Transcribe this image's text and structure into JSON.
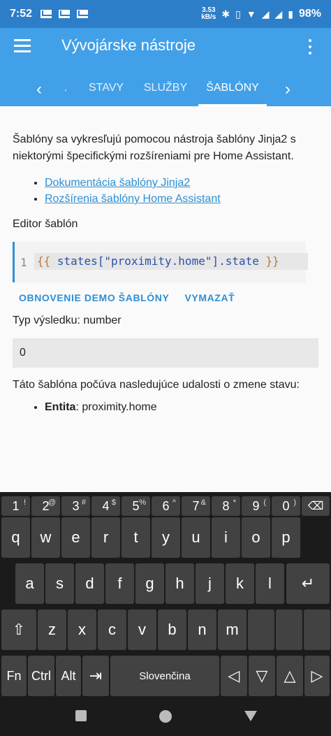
{
  "status": {
    "time": "7:52",
    "speed": "3.53\nkB/s",
    "battery": "98%"
  },
  "app": {
    "title": "Vývojárske nástroje"
  },
  "tabs": [
    {
      "label": "."
    },
    {
      "label": "STAVY"
    },
    {
      "label": "SLUŽBY"
    },
    {
      "label": "ŠABLÓNY"
    }
  ],
  "content": {
    "intro": "Šablóny sa vykresľujú pomocou nástroja šablóny Jinja2 s niektorými špecifickými rozšíreniami pre Home Assistant.",
    "links": [
      {
        "label": "Dokumentácia šablóny Jinja2"
      },
      {
        "label": "Rozšírenia šablóny Home Assistant"
      }
    ],
    "editor_label": "Editor šablón",
    "editor": {
      "line_number": "1",
      "open": "{{",
      "code": "states[\"proximity.home\"].state",
      "close": "}}"
    },
    "actions": {
      "reset": "OBNOVENIE DEMO ŠABLÓNY",
      "clear": "VYMAZAŤ"
    },
    "result_type": "Typ výsledku: number",
    "result_value": "0",
    "listen_text": "Táto šablóna počúva nasledujúce udalosti o zmene stavu:",
    "entity": {
      "label": "Entita",
      "value": ": proximity.home"
    }
  },
  "keyboard": {
    "row1": [
      {
        "k": "1",
        "s": "!"
      },
      {
        "k": "2",
        "s": "@"
      },
      {
        "k": "3",
        "s": "#"
      },
      {
        "k": "4",
        "s": "$"
      },
      {
        "k": "5",
        "s": "%"
      },
      {
        "k": "6",
        "s": "^"
      },
      {
        "k": "7",
        "s": "&"
      },
      {
        "k": "8",
        "s": "*"
      },
      {
        "k": "9",
        "s": "("
      },
      {
        "k": "0",
        "s": ")"
      }
    ],
    "row2": [
      "q",
      "w",
      "e",
      "r",
      "t",
      "y",
      "u",
      "i",
      "o",
      "p"
    ],
    "row3": [
      "a",
      "s",
      "d",
      "f",
      "g",
      "h",
      "j",
      "k",
      "l"
    ],
    "row4": [
      "z",
      "x",
      "c",
      "v",
      "b",
      "n",
      "m"
    ],
    "fn": "Fn",
    "ctrl": "Ctrl",
    "alt": "Alt",
    "space_label": "Slovenčina"
  }
}
